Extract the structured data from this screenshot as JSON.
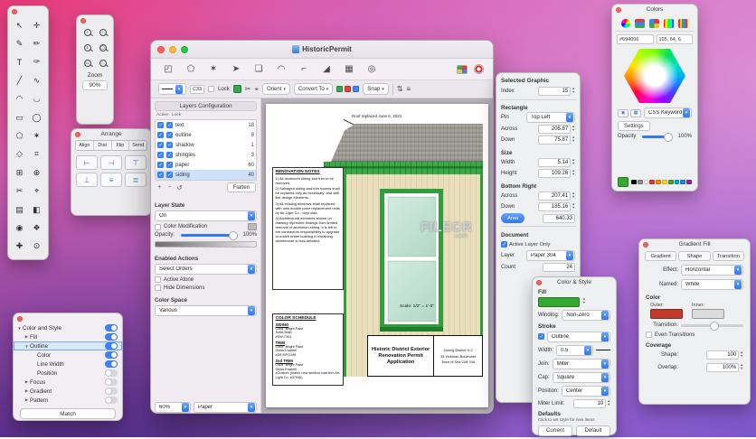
{
  "desktop": {
    "watermark_line1": "FILECR",
    "watermark_line2": ".com"
  },
  "tools_palette": {
    "tools": [
      "↖",
      "✛",
      "✎",
      "✏",
      "T",
      "✑",
      "╱",
      "∿",
      "◠",
      "◡",
      "▭",
      "◯",
      "⬠",
      "✶",
      "◇",
      "⌗",
      "⊞",
      "⊕",
      "✂",
      "⌖",
      "▤",
      "◧",
      "◉",
      "❖",
      "✚",
      "⊙"
    ]
  },
  "zoom_palette": {
    "buttons": [
      "+",
      "−",
      "1",
      "◯",
      "▭",
      "⌂"
    ],
    "label": "Zoom",
    "value": "90%"
  },
  "arrange_palette": {
    "title": "Arrange",
    "tabs": [
      "Align",
      "Dist",
      "Flip",
      "Send"
    ],
    "buttons": [
      "⊢",
      "⊣",
      "⊤",
      "⊥",
      "≡",
      "≣"
    ]
  },
  "match_palette": {
    "rows": [
      {
        "label": "Color and Style",
        "indent": 0,
        "disclosure": "▼",
        "on": true
      },
      {
        "label": "Fill",
        "indent": 1,
        "disclosure": "▶",
        "on": true
      },
      {
        "label": "Outline",
        "indent": 1,
        "disclosure": "▼",
        "on": true,
        "selected": true
      },
      {
        "label": "Color",
        "indent": 2,
        "disclosure": "",
        "on": true
      },
      {
        "label": "Line Width",
        "indent": 2,
        "disclosure": "",
        "on": true
      },
      {
        "label": "Position",
        "indent": 2,
        "disclosure": "",
        "on": false
      },
      {
        "label": "Focus",
        "indent": 1,
        "disclosure": "▶",
        "on": false
      },
      {
        "label": "Gradient",
        "indent": 1,
        "disclosure": "▶",
        "on": false
      },
      {
        "label": "Pattern",
        "indent": 1,
        "disclosure": "▶",
        "on": false
      }
    ],
    "match_button": "Match"
  },
  "main_window": {
    "title": "HistoricPermit",
    "toolbar_icons": [
      "◰",
      "⬠",
      "✶",
      "➤",
      "❏",
      "◠",
      "⌐",
      "◢",
      "▦",
      "◎"
    ],
    "toolbar2": {
      "c33": "C33",
      "lock_label": "Lock",
      "orient_label": "Orient",
      "convert_label": "Convert To",
      "snap_label": "Snap",
      "left_icons": [
        "✂",
        "⌖"
      ],
      "right_icons": [
        "⇅",
        "≡"
      ],
      "chips": [
        "#34a853",
        "#ea4335",
        "#4285f4"
      ]
    },
    "layers_panel": {
      "title": "Layers Configuration",
      "col_active": "Active",
      "col_lock": "Lock",
      "rows": [
        {
          "name": "text",
          "count": "18"
        },
        {
          "name": "outline",
          "count": "8"
        },
        {
          "name": "shadow",
          "count": "1"
        },
        {
          "name": "shingles",
          "count": "3"
        },
        {
          "name": "paper",
          "count": "60"
        },
        {
          "name": "siding",
          "count": "40",
          "selected": true
        }
      ],
      "action_icons": [
        "+",
        "−",
        "↺"
      ],
      "flatten_button": "Flatten",
      "layer_state_label": "Layer State",
      "state_value": "On",
      "color_mod_label": "Color Modification",
      "opacity_label": "Opacity:",
      "opacity_value": "100%",
      "enabled_actions_label": "Enabled Actions",
      "select_orders_value": "Select Orders",
      "active_alone_label": "Active Alone",
      "hide_dimensions_label": "Hide Dimensions",
      "color_space_label": "Color Space",
      "color_space_value": "Various",
      "zoom_value": "60%",
      "view_value": "Paper"
    },
    "canvas": {
      "annotation": "Roof replaced June 6, 2021",
      "notes_title": "RENOVATION NOTES",
      "notes": [
        "1) All aluminum siding and trim to be removed.",
        "2) Salvaged siding and trim boards shall be replaced only as necessary, and with like design elements.",
        "3) All existing windows shall replaced with new double pane replacement units by Air-Light Co.; vinyl clad.",
        "4) Architectural elements shown on drawing represent findings from limited removal of aluminum siding. It is left to the contractors responsibility to upgrade or match entire building if remaining architecture is less-detailed."
      ],
      "schedule_title": "COLOR SCHEDULE",
      "schedule": [
        {
          "head": "SIDING",
          "l1": "Color: Bright Paint",
          "l2": "Solid Stain",
          "l3": "#SW-7341"
        },
        {
          "head": "TRIM",
          "l1": "Color: Bright Paint",
          "l2": "Gloss Enamel",
          "l3": "#DE/SPG198"
        },
        {
          "head": "2nd TRIM",
          "l1": "Color: Bright Paint",
          "l2": "Gloss Enamel",
          "l3": "#Custom (match new window clad trim Air-Light Co. #37946)"
        }
      ],
      "scale_note": "Scale: 1/2\" = 1'-0\"",
      "titleblock_title1": "Historic District Exterior",
      "titleblock_title2": "Renovation Permit Application",
      "titleblock_lines": [
        "Zoning District H-2",
        "35 Victorian Boulevard",
        "Town of Sea Cliff, MA"
      ]
    }
  },
  "inspector": {
    "header": "Selected Graphic",
    "index_label": "Index",
    "index_value": "15",
    "rectangle_label": "Rectangle",
    "pin_label": "Pin",
    "pin_value": "Top Left",
    "across_label": "Across",
    "across_value": "205.87",
    "down_label": "Down",
    "down_value": "75.87",
    "size_label": "Size",
    "width_label": "Width",
    "width_value": "5.14",
    "height_label": "Height",
    "height_value": "109.26",
    "bottom_right_label": "Bottom Right",
    "br_across_label": "Across",
    "br_across_value": "207.41",
    "br_down_label": "Down",
    "br_down_value": "185.16",
    "area_button": "Area",
    "area_value": "640.33",
    "document_label": "Document",
    "active_layer_only": "Active Layer Only",
    "layer_label": "Layer",
    "layer_value": "Paper 304",
    "count_label": "Count",
    "count_value": "24"
  },
  "colors_panel": {
    "title": "Colors",
    "hex_value": "#694006",
    "rgb_value": "105, 64, 6",
    "small_buttons": [
      "◉",
      "▦"
    ],
    "css_keyword": "CSS Keyword",
    "settings_button": "Settings",
    "opacity_label": "Opacity",
    "opacity_value": "100%",
    "current_color": "#35a832",
    "swatches": [
      "#000000",
      "#8e8e8e",
      "#ffffff",
      "#e53935",
      "#fb8c00",
      "#fdd835",
      "#43a047",
      "#00acc1",
      "#1e88e5",
      "#8e24aa"
    ]
  },
  "gradient_panel": {
    "title": "Gradient Fill",
    "tabs": [
      "Gradient",
      "Shape",
      "Transition"
    ],
    "effect_label": "Effect:",
    "effect_value": "Horizontal",
    "named_label": "Named:",
    "named_value": "White",
    "color_label": "Color",
    "outer_label": "Outer:",
    "inner_label": "Inner:",
    "outer_color": "#c03a2b",
    "inner_color": "#dcdcdc",
    "transition_label": "Transition:",
    "even_transitions": "Even Transitions",
    "coverage_label": "Coverage",
    "shape_label": "Shape:",
    "shape_value": "100",
    "overlap_label": "Overlap:",
    "overlap_value": "100%"
  },
  "style_panel": {
    "title": "Color & Style",
    "fill_label": "Fill",
    "fill_color": "#35a832",
    "winding_label": "Winding:",
    "winding_value": "Non-Zero",
    "stroke_label": "Stroke",
    "outline_value": "Outline",
    "width_label": "Width:",
    "width_value": "0.5",
    "join_label": "Join:",
    "join_value": "Miter",
    "cap_label": "Cap:",
    "cap_value": "Square",
    "position_label": "Position:",
    "position_value": "Center",
    "miter_label": "Miter Limit:",
    "miter_value": "10",
    "defaults_label": "Defaults",
    "defaults_hint": "Click to set Style for new items",
    "current_button": "Current",
    "default_button": "Default"
  }
}
